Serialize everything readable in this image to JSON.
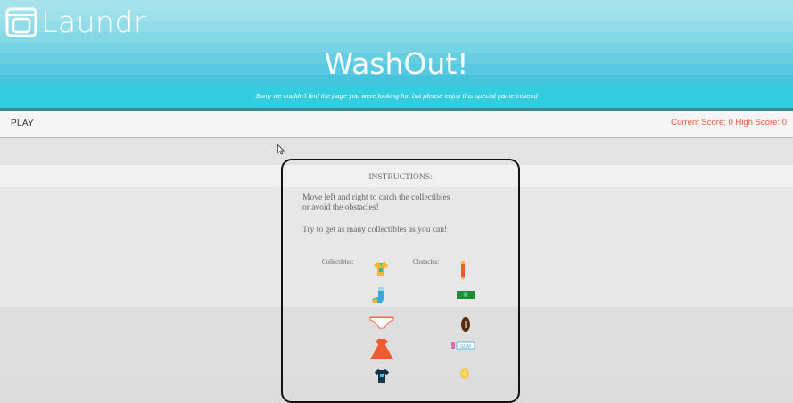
{
  "header": {
    "logo_text": "Laundr",
    "title": "WashOut!",
    "subtitle": "Sorry we couldn't find the page you were looking for, but please enjoy this special game instead"
  },
  "toolbar": {
    "play_label": "PLAY",
    "score_text": "Current Score: 0 High Score: 0"
  },
  "instructions": {
    "title": "INSTRUCTIONS:",
    "line1": "Move left and right to catch the collectibles",
    "line2": "or avoid the obstacles!",
    "line3": "Try to get as many collectibles as you can!",
    "collectibles_label": "Collectibles:",
    "obstacles_label": "Obstacles:",
    "collectibles": [
      "shirt-icon",
      "sock-icon",
      "underwear-icon",
      "dress-icon",
      "jersey-icon"
    ],
    "obstacles": [
      "pen-icon",
      "cash-icon",
      "football-icon",
      "gum-icon",
      "coin-icon"
    ],
    "gum_text": "GUM"
  },
  "colors": {
    "header_bg": "#33cde0",
    "score": "#e8583a"
  }
}
